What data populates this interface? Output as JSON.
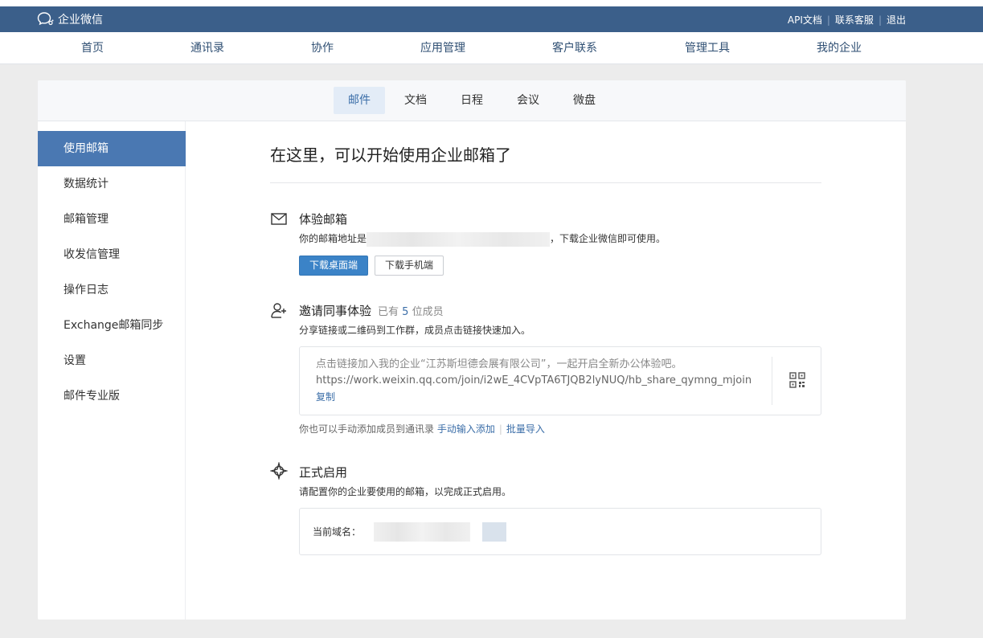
{
  "app": {
    "logo_text": "企业微信"
  },
  "top_links": {
    "api_docs": "API文档",
    "contact_support": "联系客服",
    "logout": "退出",
    "separator": "|"
  },
  "main_nav": [
    {
      "label": "首页"
    },
    {
      "label": "通讯录"
    },
    {
      "label": "协作"
    },
    {
      "label": "应用管理"
    },
    {
      "label": "客户联系"
    },
    {
      "label": "管理工具"
    },
    {
      "label": "我的企业"
    }
  ],
  "sub_nav": [
    {
      "label": "邮件"
    },
    {
      "label": "文档"
    },
    {
      "label": "日程"
    },
    {
      "label": "会议"
    },
    {
      "label": "微盘"
    }
  ],
  "sidebar": [
    {
      "label": "使用邮箱"
    },
    {
      "label": "数据统计"
    },
    {
      "label": "邮箱管理"
    },
    {
      "label": "收发信管理"
    },
    {
      "label": "操作日志"
    },
    {
      "label": "Exchange邮箱同步"
    },
    {
      "label": "设置"
    },
    {
      "label": "邮件专业版"
    }
  ],
  "page": {
    "title": "在这里，可以开始使用企业邮箱了"
  },
  "trial": {
    "title": "体验邮箱",
    "desc_prefix": "你的邮箱地址是",
    "desc_suffix": "，下载企业微信即可使用。",
    "btn_desktop": "下载桌面端",
    "btn_mobile": "下载手机端"
  },
  "invite": {
    "title": "邀请同事体验",
    "count_prefix": "已有",
    "count": "5",
    "count_suffix": "位成员",
    "desc": "分享链接或二维码到工作群，成员点击链接快速加入。",
    "share_text": "点击链接加入我的企业“江苏斯坦德会展有限公司”，一起开启全新办公体验吧。",
    "share_url": "https://work.weixin.qq.com/join/i2wE_4CVpTA6TJQB2lyNUQ/hb_share_qymng_mjoin",
    "copy": "复制",
    "manual_text": "你也可以手动添加成员到通讯录",
    "manual_add": "手动输入添加",
    "batch_import": "批量导入"
  },
  "formal": {
    "title": "正式启用",
    "desc": "请配置你的企业要使用的邮箱，以完成正式启用。",
    "domain_label": "当前域名："
  }
}
